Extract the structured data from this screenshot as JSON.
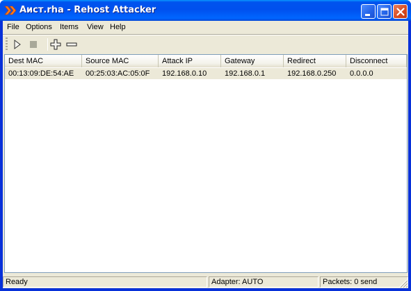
{
  "window": {
    "title": "Аист.rha - Rehost Attacker",
    "icons": {
      "app": "double-chevron-icon",
      "minimize": "minimize-icon",
      "maximize": "maximize-icon",
      "close": "close-icon"
    }
  },
  "menu": {
    "items": [
      {
        "label": "File"
      },
      {
        "label": "Options"
      },
      {
        "label": "Items"
      },
      {
        "label": "View"
      },
      {
        "label": "Help"
      }
    ]
  },
  "toolbar": {
    "buttons": [
      {
        "icon": "play-icon",
        "enabled": true
      },
      {
        "icon": "stop-icon",
        "enabled": false
      },
      {
        "icon": "add-icon",
        "enabled": true
      },
      {
        "icon": "remove-icon",
        "enabled": true
      }
    ]
  },
  "table": {
    "columns": [
      "Dest MAC",
      "Source MAC",
      "Attack IP",
      "Gateway",
      "Redirect",
      "Disconnect"
    ],
    "rows": [
      [
        "00:13:09:DE:54:AE",
        "00:25:03:AC:05:0F",
        "192.168.0.10",
        "192.168.0.1",
        "192.168.0.250",
        "0.0.0.0"
      ]
    ]
  },
  "status": {
    "state": "Ready",
    "adapter": "Adapter: AUTO",
    "packets": "Packets: 0 send"
  }
}
